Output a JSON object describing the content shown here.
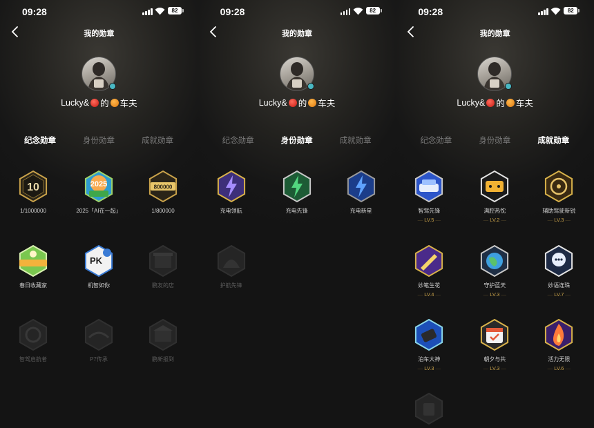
{
  "status": {
    "time": "09:28",
    "battery": "82"
  },
  "header": {
    "title": "我的勋章"
  },
  "profile": {
    "name_prefix": "Lucky&",
    "name_mid": "的",
    "name_suffix": "车夫"
  },
  "tabs": [
    "纪念勋章",
    "身份勋章",
    "成就勋章"
  ],
  "colors": {
    "accent_gold": "#c9a24a",
    "bg": "#141414",
    "inactive_text": "#7a7a7a"
  },
  "panels": [
    {
      "active_tab": 0,
      "badges": [
        {
          "label": "1/1000000",
          "icon": "badge-10-icon",
          "lit": true
        },
        {
          "label": "2025「AI在一起」",
          "icon": "badge-2025-icon",
          "lit": true
        },
        {
          "label": "1/800000",
          "icon": "badge-800000-icon",
          "lit": true
        },
        {
          "label": "春日收藏家",
          "icon": "badge-spring-collector-icon",
          "lit": true
        },
        {
          "label": "机智如你",
          "icon": "badge-pk-icon",
          "lit": true
        },
        {
          "label": "鹏友的店",
          "icon": "badge-store-icon",
          "lit": false
        },
        {
          "label": "智驾启航者",
          "icon": "badge-pilot-icon",
          "lit": false
        },
        {
          "label": "P7传承",
          "icon": "badge-p7-icon",
          "lit": false
        },
        {
          "label": "鹏新报到",
          "icon": "badge-newcomer-icon",
          "lit": false
        }
      ]
    },
    {
      "active_tab": 1,
      "badges": [
        {
          "label": "充电领航",
          "icon": "badge-charge-leader-icon",
          "lit": true
        },
        {
          "label": "充电先锋",
          "icon": "badge-charge-pioneer-icon",
          "lit": true
        },
        {
          "label": "充电新星",
          "icon": "badge-charge-star-icon",
          "lit": true
        },
        {
          "label": "护航先锋",
          "icon": "badge-escort-icon",
          "lit": false
        }
      ]
    },
    {
      "active_tab": 2,
      "badges": [
        {
          "label": "智驾先锋",
          "icon": "badge-smart-drive-icon",
          "lit": true,
          "level": "LV.5"
        },
        {
          "label": "满腔热忱",
          "icon": "badge-enthusiasm-icon",
          "lit": true,
          "level": "LV.2"
        },
        {
          "label": "辅助驾驶新锐",
          "icon": "badge-assist-drive-icon",
          "lit": true,
          "level": "LV.3"
        },
        {
          "label": "妙笔生花",
          "icon": "badge-pen-icon",
          "lit": true,
          "level": "LV.4"
        },
        {
          "label": "守护蓝天",
          "icon": "badge-earth-icon",
          "lit": true,
          "level": "LV.3"
        },
        {
          "label": "妙语连珠",
          "icon": "badge-chat-icon",
          "lit": true,
          "level": "LV.7"
        },
        {
          "label": "泊车大神",
          "icon": "badge-parking-icon",
          "lit": true,
          "level": "LV.3"
        },
        {
          "label": "朝夕与共",
          "icon": "badge-calendar-icon",
          "lit": true,
          "level": "LV.3"
        },
        {
          "label": "活力无限",
          "icon": "badge-fire-icon",
          "lit": true,
          "level": "LV.6"
        },
        {
          "label": "",
          "icon": "badge-locked-icon",
          "lit": false
        }
      ]
    }
  ]
}
